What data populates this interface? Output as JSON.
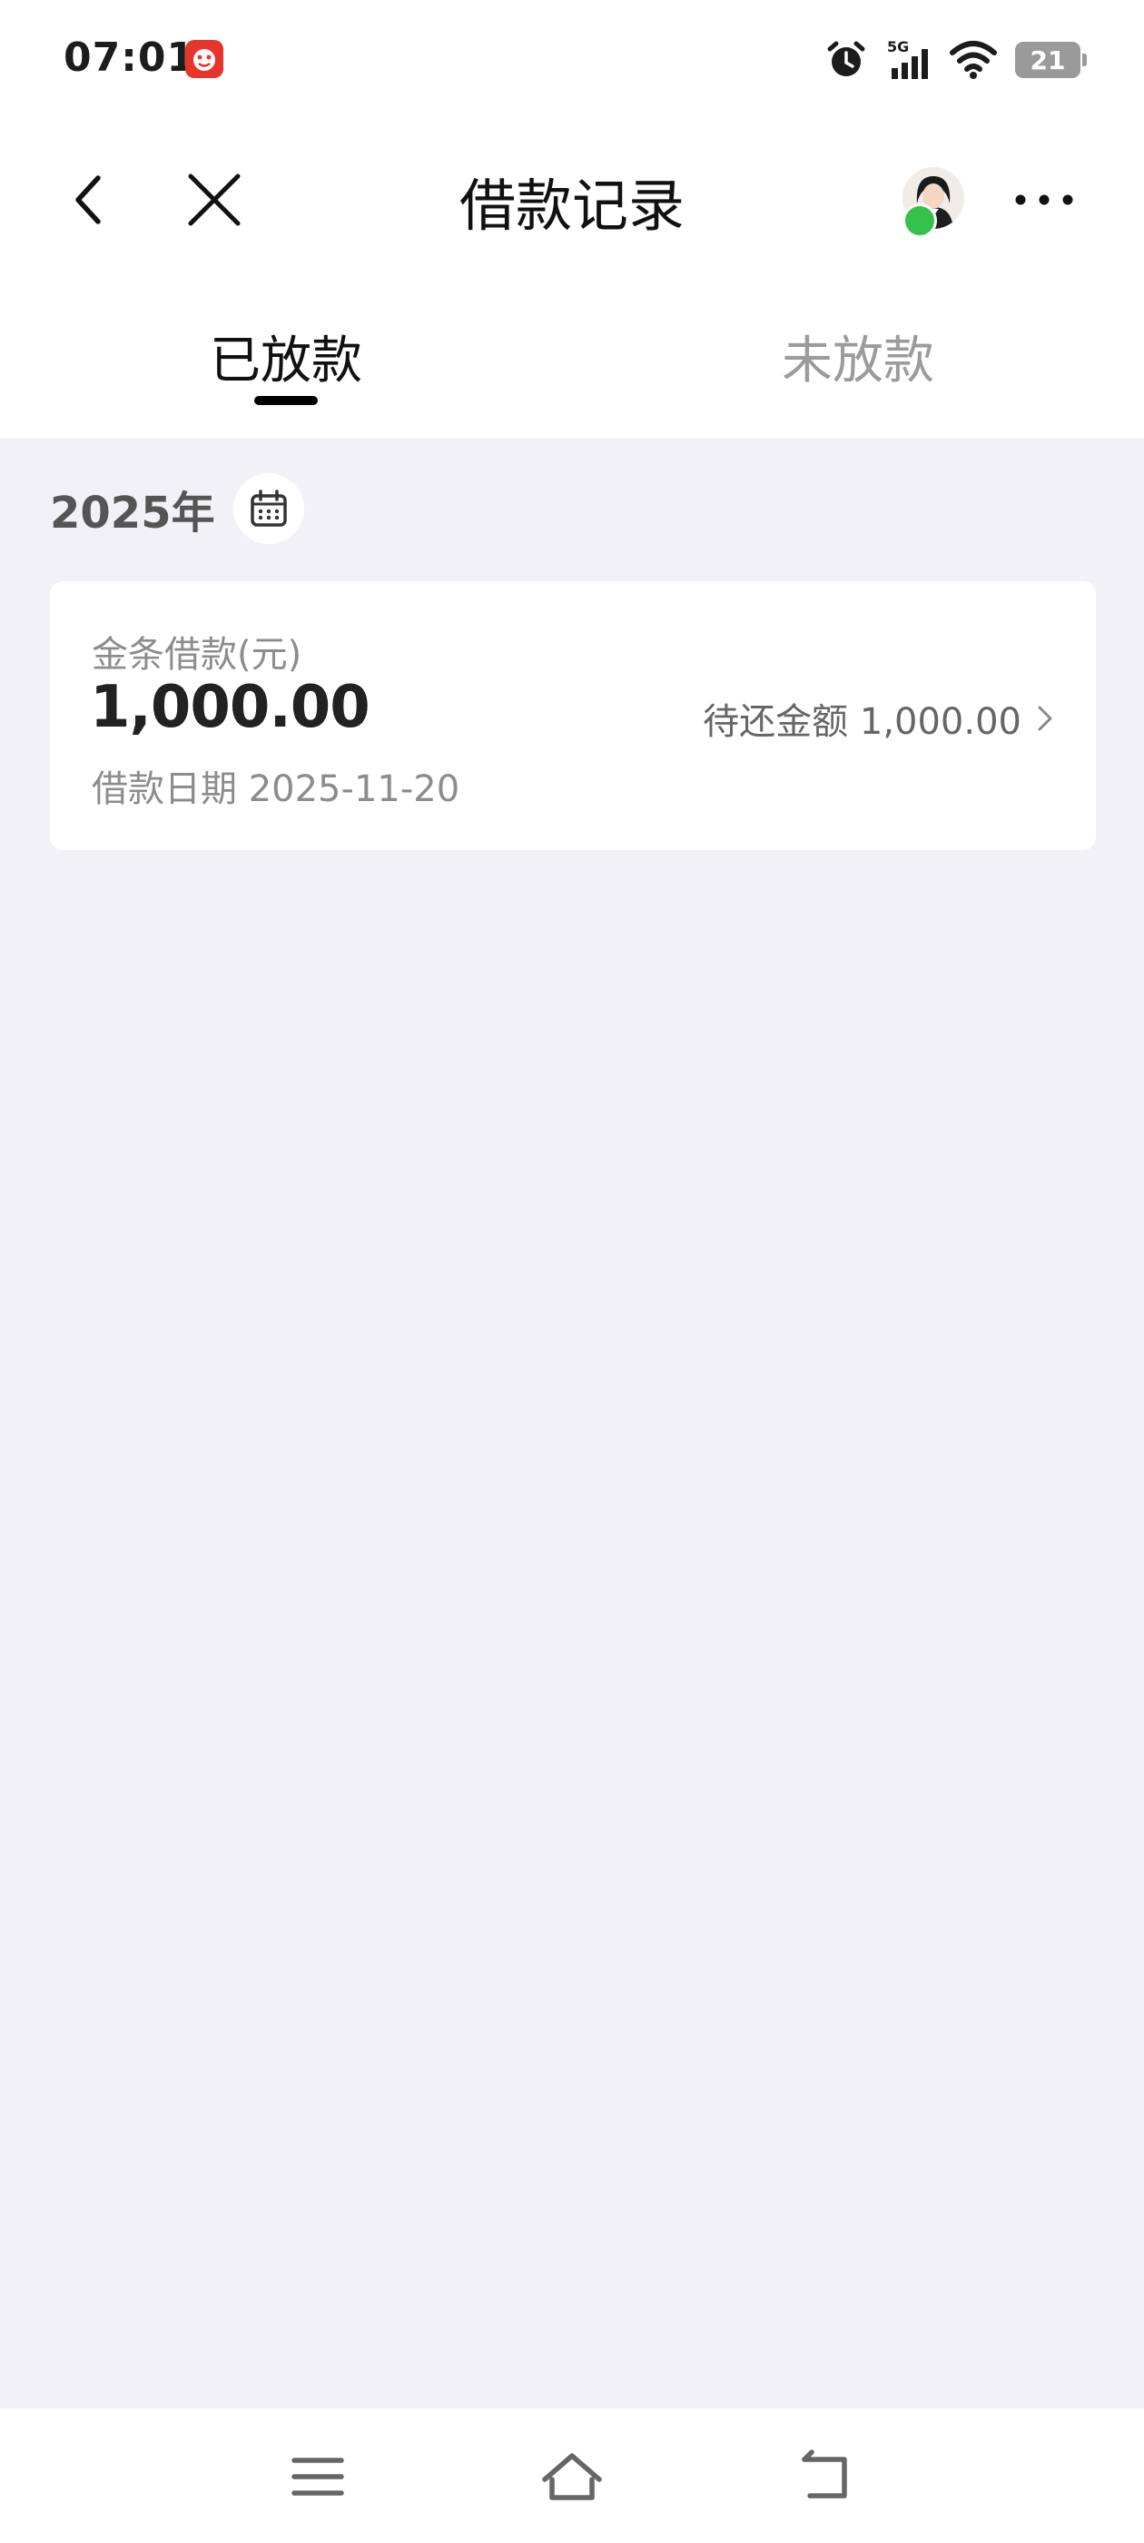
{
  "status_bar": {
    "time": "07:01",
    "app_badge_icon": "red-app-icon",
    "icons": [
      "alarm-icon",
      "5g-signal-icon",
      "wifi-icon",
      "battery-icon"
    ],
    "network": "5G",
    "battery_level": "21"
  },
  "nav": {
    "title": "借款记录",
    "back_icon": "back-arrow-icon",
    "close_icon": "close-icon",
    "more_icon": "more-dots-icon"
  },
  "tabs": [
    {
      "label": "已放款",
      "active": true
    },
    {
      "label": "未放款",
      "active": false
    }
  ],
  "year_section": {
    "year_label": "2025年",
    "calendar_icon": "calendar-icon"
  },
  "loans": [
    {
      "type_label": "金条借款(元)",
      "amount": "1,000.00",
      "outstanding_label": "待还金额 1,000.00",
      "date_label": "借款日期 2025-11-20"
    }
  ],
  "system_nav": {
    "icons": [
      "menu-icon",
      "home-icon",
      "back-icon"
    ]
  },
  "colors": {
    "page_background": "#f2f2f6",
    "card_background": "#ffffff",
    "tab_indicator": "#000000",
    "muted_text": "#8c8c8c"
  }
}
